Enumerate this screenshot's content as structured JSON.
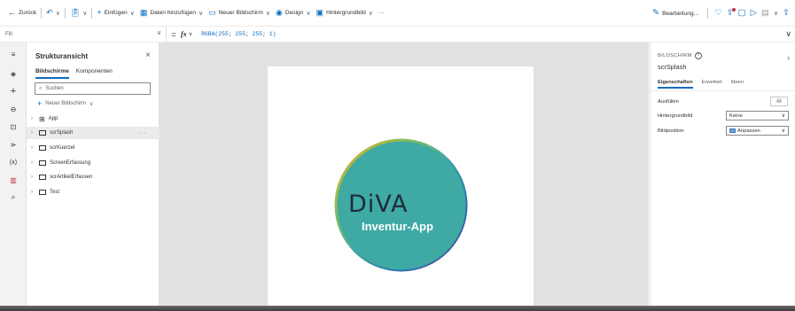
{
  "toolbar": {
    "back": "Zurück",
    "insert": "Einfügen",
    "add_data": "Daten hinzufügen",
    "new_screen": "Neuer Bildschirm",
    "design": "Design",
    "background_image": "Hintergrundbild",
    "more": "···",
    "edit": "Bearbeitung..."
  },
  "formula_bar": {
    "property": "Fill",
    "formula": "RGBA(255; 255; 255; 1)"
  },
  "tree_view": {
    "title": "Strukturansicht",
    "tabs": [
      "Bildschirme",
      "Komponenten"
    ],
    "search_placeholder": "Suchen",
    "new_screen": "Neuer Bildschirm",
    "items": [
      {
        "label": "App"
      },
      {
        "label": "scrSplash",
        "more": "···"
      },
      {
        "label": "scrKuerzel"
      },
      {
        "label": "ScreenErfassung"
      },
      {
        "label": "scrArtikelErfassen"
      },
      {
        "label": "Test"
      }
    ]
  },
  "canvas": {
    "logo_text": "DiVA",
    "logo_subtitle": "Inventur-App",
    "accent": "#3fa9a4"
  },
  "properties": {
    "kicker": "BILDSCHIRM",
    "screen_name": "scrSplash",
    "tabs": [
      "Eigenschaften",
      "Erweitert",
      "Ideen"
    ],
    "fill_label": "Ausfüllen",
    "bg_image_label": "Hintergrundbild",
    "bg_image_value": "Keine",
    "image_position_label": "Bildposition",
    "image_position_value": "Anpassen"
  }
}
